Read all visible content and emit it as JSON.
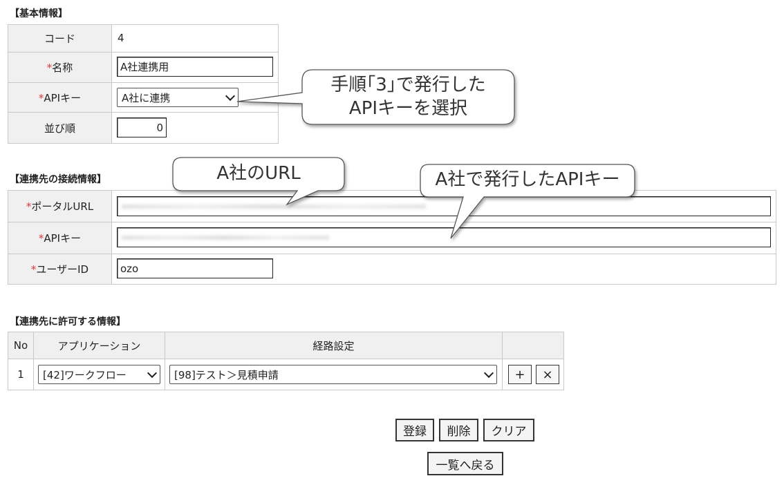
{
  "basic": {
    "title": "【基本情報】",
    "code_label": "コード",
    "code_value": "4",
    "required_mark": "*",
    "name_label": "名称",
    "name_value": "A社連携用",
    "apikey_label": "APIキー",
    "apikey_selected": "A社に連携",
    "order_label": "並び順",
    "order_value": "0"
  },
  "connection": {
    "title": "【連携先の接続情報】",
    "portal_label": "ポータルURL",
    "apikey_label": "APIキー",
    "userid_label": "ユーザーID",
    "userid_value": "ozo"
  },
  "permissions": {
    "title": "【連携先に許可する情報】",
    "headers": [
      "No",
      "アプリケーション",
      "経路設定"
    ],
    "rows": [
      {
        "no": "1",
        "application": "[42]ワークフロー",
        "route": "[98]テスト＞見積申請"
      }
    ],
    "add_label": "+",
    "remove_label": "×"
  },
  "actions": {
    "register": "登録",
    "delete": "削除",
    "clear": "クリア",
    "back": "一覧へ戻る"
  },
  "callouts": {
    "apikey_select_line1": "手順｢3｣で発行した",
    "apikey_select_line2": "APIキーを選択",
    "url": "A社のURL",
    "apikey_issued": "A社で発行したAPIキー"
  }
}
